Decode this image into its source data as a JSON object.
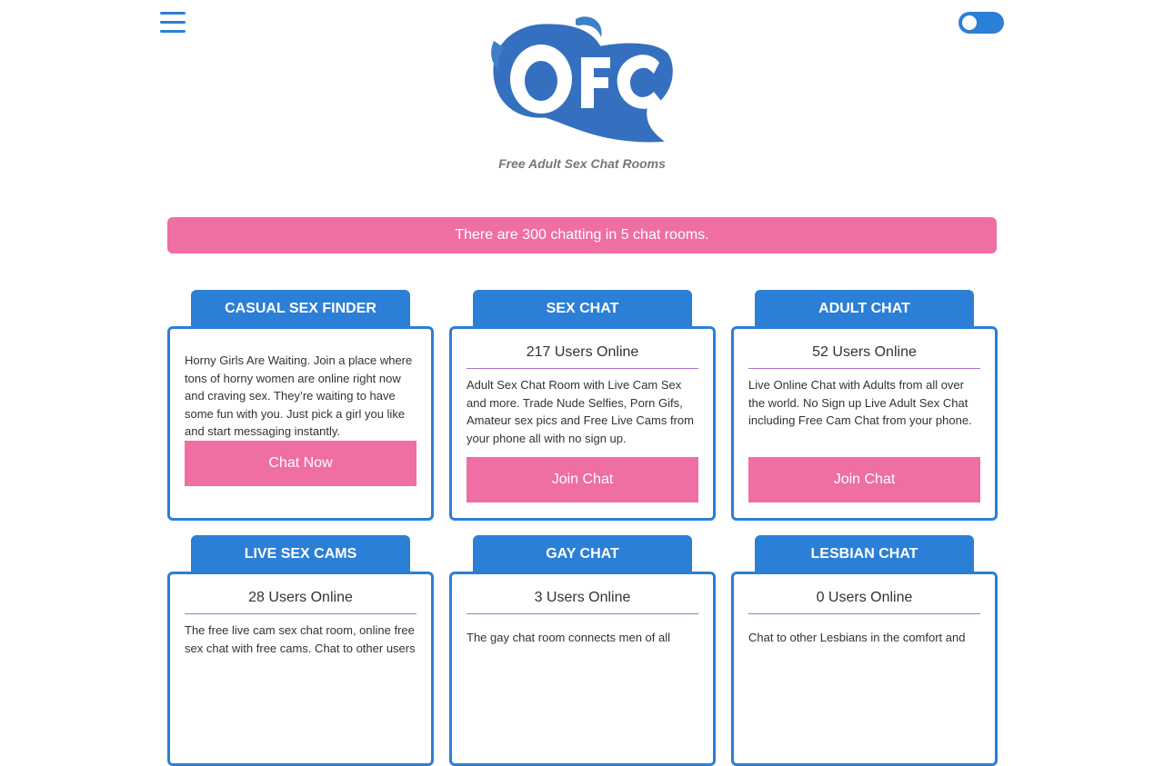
{
  "header": {
    "tagline": "Free Adult Sex Chat Rooms",
    "logo_text": "OFC",
    "menu_icon": "hamburger-icon",
    "theme_toggle": "toggle-switch"
  },
  "banner": {
    "text": "There are 300 chatting in 5 chat rooms."
  },
  "colors": {
    "accent": "#2b7fd6",
    "pink": "#ef6ea3",
    "divider": "#b070c8"
  },
  "cards": [
    {
      "title": "CASUAL SEX FINDER",
      "online": "",
      "desc": "Horny Girls Are Waiting. Join a place where tons of horny women are online right now and craving sex. They’re waiting to have some fun with you. Just pick a girl you like and start messaging instantly.",
      "button": "Chat Now"
    },
    {
      "title": "SEX CHAT",
      "online": "217 Users Online",
      "desc": "Adult Sex Chat Room with Live Cam Sex and more. Trade Nude Selfies, Porn Gifs, Amateur sex pics and Free Live Cams from your phone all with no sign up.",
      "button": "Join Chat"
    },
    {
      "title": "ADULT CHAT",
      "online": "52 Users Online",
      "desc": "Live Online Chat with Adults from all over the world. No Sign up Live Adult Sex Chat including Free Cam Chat from your phone.",
      "button": "Join Chat"
    },
    {
      "title": "LIVE SEX CAMS",
      "online": "28 Users Online",
      "desc": "The free live cam sex chat room, online free sex chat with free cams. Chat to other users",
      "button": ""
    },
    {
      "title": "GAY CHAT",
      "online": "3 Users Online",
      "desc": "The gay chat room connects men of all",
      "button": ""
    },
    {
      "title": "LESBIAN CHAT",
      "online": "0 Users Online",
      "desc": "Chat to other Lesbians in the comfort and",
      "button": ""
    }
  ]
}
